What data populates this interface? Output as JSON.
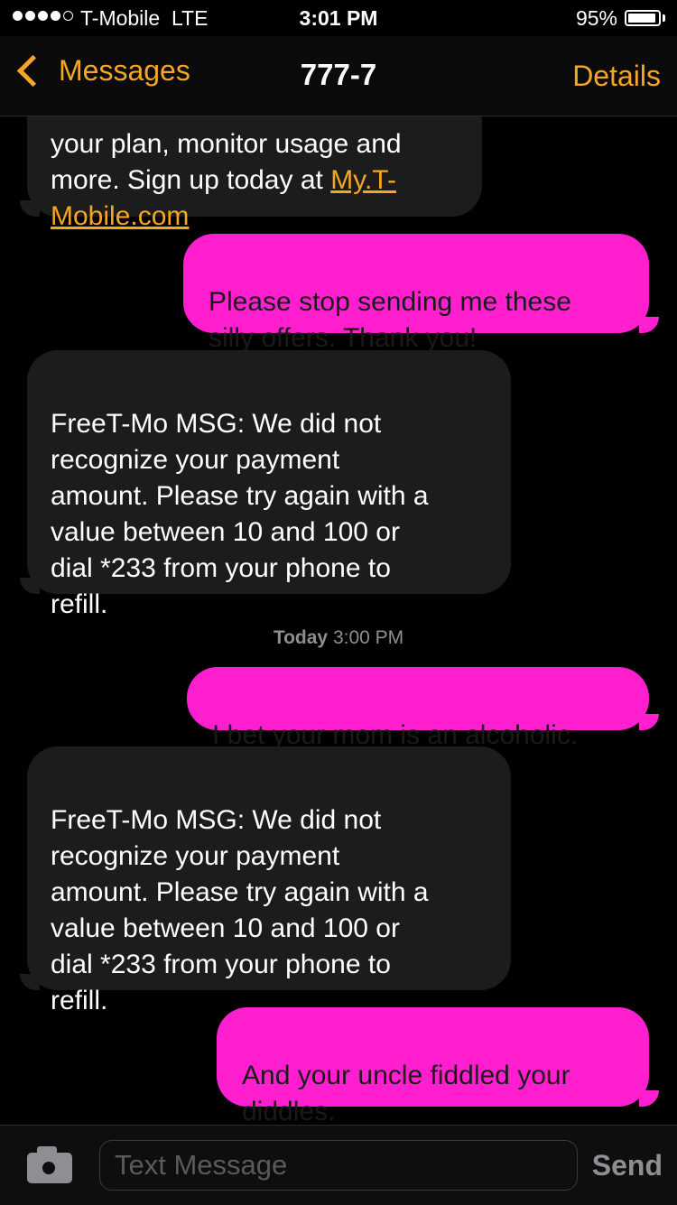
{
  "status_bar": {
    "carrier": "T-Mobile  LTE",
    "time": "3:01 PM",
    "battery": "95%",
    "battery_level": 0.95,
    "signal_bars_filled": 4,
    "signal_bars_total": 5
  },
  "nav": {
    "back_label": "Messages",
    "title": "777-7",
    "details_label": "Details"
  },
  "colors": {
    "accent": "#f5a623",
    "outgoing_bubble": "#ff1fcf",
    "incoming_bubble": "#1c1c1c"
  },
  "messages": [
    {
      "direction": "in",
      "text_before_link": "your plan, monitor usage and\nmore.  Sign up today at ",
      "link": "My.T-\nMobile.com"
    },
    {
      "direction": "out",
      "text": "Please stop sending me these\nsilly offers. Thank you!"
    },
    {
      "direction": "in",
      "text": "FreeT-Mo MSG: We did not\nrecognize your payment\namount. Please try again with a\nvalue between 10 and 100 or\ndial *233 from your phone to\nrefill."
    },
    {
      "direction": "out",
      "text": "I bet your mom is an alcoholic."
    },
    {
      "direction": "in",
      "text": "FreeT-Mo MSG: We did not\nrecognize your payment\namount. Please try again with a\nvalue between 10 and 100 or\ndial *233 from your phone to\nrefill."
    },
    {
      "direction": "out",
      "text": "And your uncle fiddled your\ndiddles."
    }
  ],
  "timestamp": {
    "day": "Today",
    "time": "3:00 PM"
  },
  "input": {
    "placeholder": "Text Message",
    "send_label": "Send",
    "camera_icon": "camera-icon"
  }
}
